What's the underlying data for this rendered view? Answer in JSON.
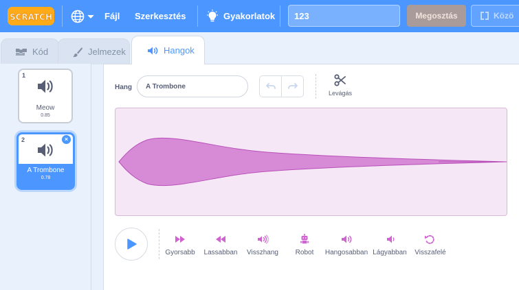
{
  "menubar": {
    "logo_text": "SCRATCH",
    "file_label": "Fájl",
    "edit_label": "Szerkesztés",
    "tutorials_label": "Gyakorlatok",
    "project_title_value": "123",
    "share_label": "Megosztás",
    "community_label": "Közö",
    "colors": {
      "bar": "#4c97ff",
      "share_disabled": "#a89b9a",
      "logo": "#ffab19"
    }
  },
  "tabs": [
    {
      "label": "Kód",
      "icon": "code-icon",
      "active": false
    },
    {
      "label": "Jelmezek",
      "icon": "paintbrush-icon",
      "active": false
    },
    {
      "label": "Hangok",
      "icon": "speaker-icon",
      "active": true
    }
  ],
  "sounds": [
    {
      "number": "1",
      "name": "Meow",
      "duration": "0.85",
      "selected": false
    },
    {
      "number": "2",
      "name": "A Trombone",
      "duration": "0.78",
      "selected": true
    }
  ],
  "editor": {
    "name_label": "Hang",
    "name_value": "A Trombone",
    "trim_label": "Levágás",
    "waveform_color": "#cf63cf",
    "effects": [
      {
        "label": "Gyorsabb",
        "icon": "faster-icon"
      },
      {
        "label": "Lassabban",
        "icon": "slower-icon"
      },
      {
        "label": "Visszhang",
        "icon": "echo-icon"
      },
      {
        "label": "Robot",
        "icon": "robot-icon"
      },
      {
        "label": "Hangosabban",
        "icon": "louder-icon"
      },
      {
        "label": "Lágyabban",
        "icon": "softer-icon"
      },
      {
        "label": "Visszafelé",
        "icon": "reverse-icon"
      }
    ]
  }
}
